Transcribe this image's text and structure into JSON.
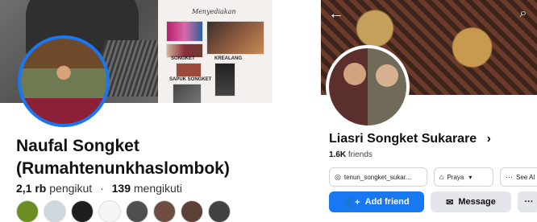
{
  "left_profile": {
    "collage_title": "Menyediakan",
    "captions": [
      "SONGKET",
      "KREALANG",
      "SAPUK SONGKET"
    ],
    "name_line1": "Naufal Songket",
    "name_line2": "(Rumahtenunkhaslombok)",
    "followers": "2,1 rb",
    "followers_label": "pengikut",
    "following": "139",
    "following_label": "mengikuti",
    "dot": "·",
    "follower_avatars": [
      "avatar-1",
      "avatar-2",
      "avatar-3",
      "avatar-4",
      "avatar-5",
      "avatar-6",
      "avatar-7",
      "avatar-8"
    ],
    "colors": {
      "avatar_border": "#1877f2",
      "follower_avatar_colors": [
        "#6b8e23",
        "#cfd8dc",
        "#1e1e1e",
        "#f5f5f5",
        "#4f4f4f",
        "#6d4c41",
        "#5d4037",
        "#424242"
      ]
    }
  },
  "right_profile": {
    "name": "Liasri Songket Sukarare",
    "chevron": "›",
    "friends_count": "1.6K",
    "friends_label": "friends",
    "chips": {
      "instagram": "tenun_songket_sukar...",
      "location": "Praya",
      "see_all": "See Al"
    },
    "buttons": {
      "add_friend": "Add friend",
      "message": "Message",
      "more": "···"
    },
    "icons": {
      "back": "←",
      "search": "⌕",
      "instagram": "◎",
      "home": "⌂",
      "dropdown": "▾",
      "add_friend": "👤+",
      "message": "✉"
    },
    "colors": {
      "primary": "#1877f2",
      "button_gray": "#e4e6eb"
    }
  }
}
